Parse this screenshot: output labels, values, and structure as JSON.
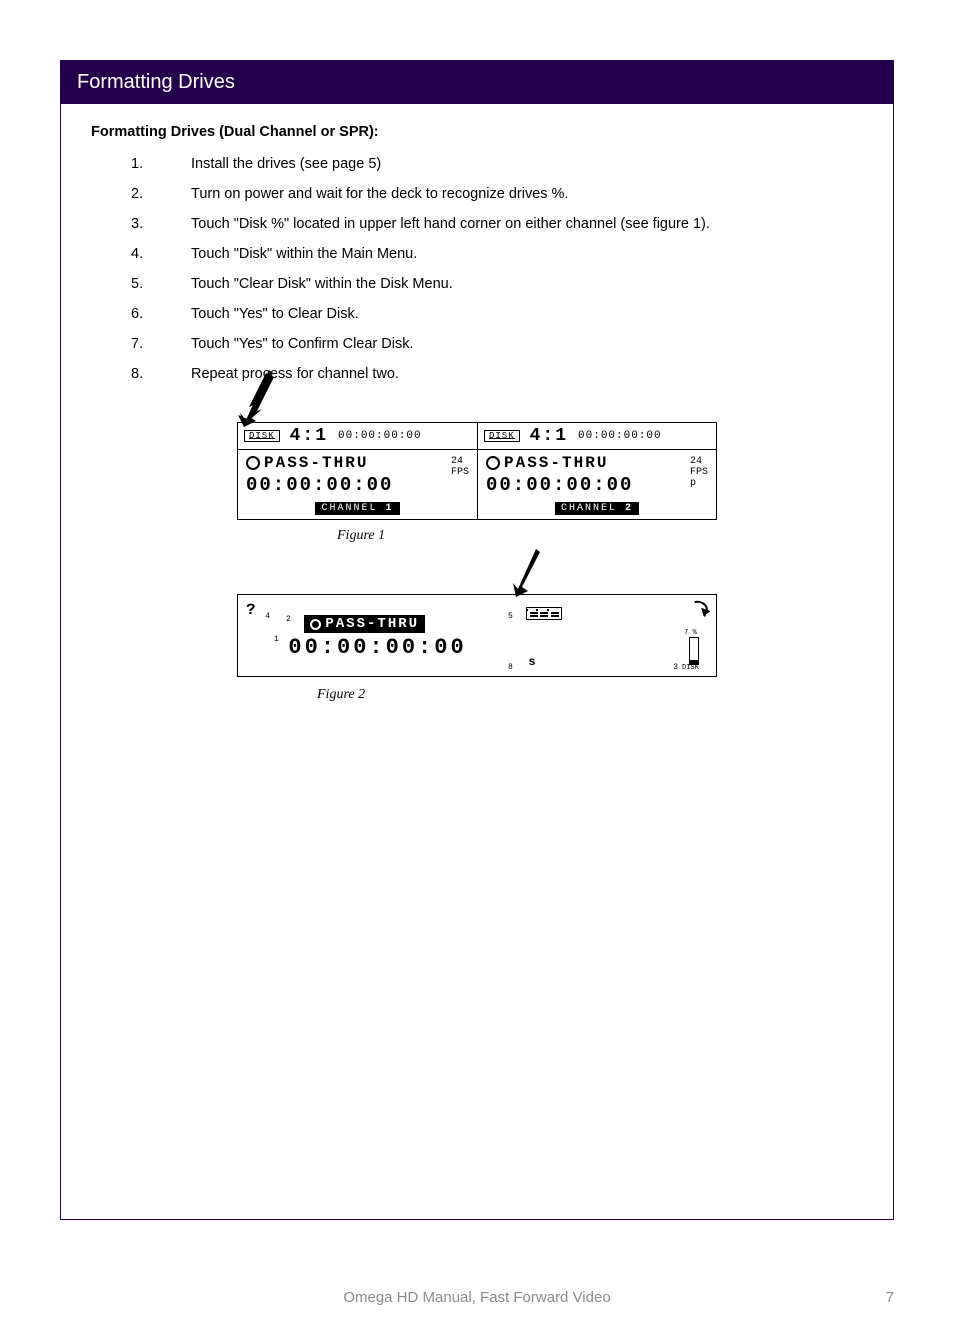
{
  "section_title": "Formatting Drives",
  "subhead": "Formatting Drives (Dual Channel or SPR):",
  "steps": [
    {
      "n": "1.",
      "t": "Install the drives (see page 5)"
    },
    {
      "n": "2.",
      "t": "Turn on power and wait for the deck to recognize drives %."
    },
    {
      "n": "3.",
      "t": "Touch \"Disk %\" located in upper left hand corner on either channel (see figure 1)."
    },
    {
      "n": "4.",
      "t": "Touch \"Disk\" within the Main Menu."
    },
    {
      "n": "5.",
      "t": "Touch \"Clear Disk\" within the Disk Menu."
    },
    {
      "n": "6.",
      "t": "Touch \"Yes\" to Clear Disk."
    },
    {
      "n": "7.",
      "t": "Touch \"Yes\" to Confirm Clear Disk."
    },
    {
      "n": "8.",
      "t": "Repeat process for channel two."
    }
  ],
  "panel": {
    "disk_label": "DISK",
    "ratio": "4:1",
    "tc_small": "00:00:00:00",
    "pass_label": "PASS-THRU",
    "tc_big": "00:00:00:00",
    "fps_num": "24",
    "fps_lbl": "FPS",
    "p_lbl": "p",
    "ch1": "CHANNEL ",
    "ch1n": "1",
    "ch2": "CHANNEL ",
    "ch2n": "2"
  },
  "fig1": "Figure 1",
  "single": {
    "q": "?",
    "n4": "4",
    "n2": "2",
    "n1": "1",
    "pass": "PASS-THRU",
    "tc": "00:00:00:00",
    "n5": "5",
    "n8": "8",
    "s": "s",
    "n3": "3",
    "pct": "7 %",
    "dsk": "DISK"
  },
  "fig2": "Figure 2",
  "footer_center": "Omega HD Manual, Fast Forward Video",
  "footer_right": "7"
}
